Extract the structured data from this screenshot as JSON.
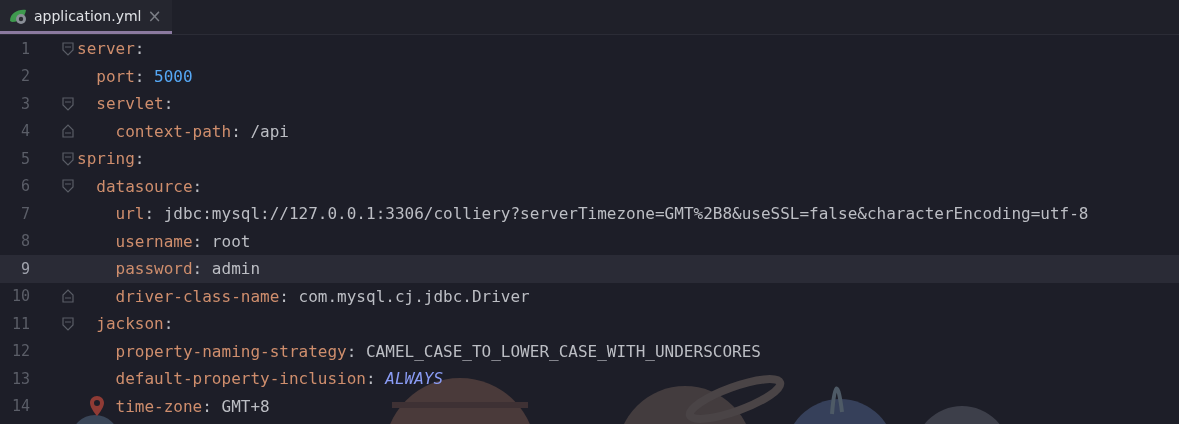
{
  "tabs": [
    {
      "label": "application.yml",
      "selected": true,
      "close": "×"
    }
  ],
  "lines": [
    {
      "number": "1",
      "key": "server",
      "separator": ":",
      "current": false,
      "marked": false,
      "children": [
        {
          "number": "2",
          "key": "port",
          "separator": ":",
          "value": "5000",
          "kind": "number",
          "current": false,
          "marked": false
        },
        {
          "number": "3",
          "key": "servlet",
          "separator": ":",
          "current": false,
          "marked": false,
          "children": [
            {
              "number": "4",
              "key": "context-path",
              "separator": ":",
              "value": "/api",
              "kind": "string",
              "current": false,
              "marked": false
            }
          ]
        }
      ]
    },
    {
      "number": "5",
      "key": "spring",
      "separator": ":",
      "current": false,
      "marked": false,
      "children": [
        {
          "number": "6",
          "key": "datasource",
          "separator": ":",
          "current": false,
          "marked": false,
          "children": [
            {
              "number": "7",
              "key": "url",
              "separator": ":",
              "value": "jdbc:mysql://127.0.0.1:3306/colliery?serverTimezone=GMT%2B8&useSSL=false&characterEncoding=utf-8",
              "kind": "string",
              "current": false,
              "marked": false
            },
            {
              "number": "8",
              "key": "username",
              "separator": ":",
              "value": "root",
              "kind": "string",
              "current": false,
              "marked": false
            },
            {
              "number": "9",
              "key": "password",
              "separator": ":",
              "value": "admin",
              "kind": "string",
              "current": true,
              "marked": false
            },
            {
              "number": "10",
              "key": "driver-class-name",
              "separator": ":",
              "value": "com.mysql.cj.jdbc.Driver",
              "kind": "string",
              "current": false,
              "marked": false
            }
          ]
        },
        {
          "number": "11",
          "key": "jackson",
          "separator": ":",
          "current": false,
          "marked": false,
          "children": [
            {
              "number": "12",
              "key": "property-naming-strategy",
              "separator": ":",
              "value": "CAMEL_CASE_TO_LOWER_CASE_WITH_UNDERSCORES",
              "kind": "string",
              "current": false,
              "marked": false
            },
            {
              "number": "13",
              "key": "default-property-inclusion",
              "separator": ":",
              "value": "ALWAYS",
              "kind": "constant",
              "current": false,
              "marked": false
            },
            {
              "number": "14",
              "key": "time-zone",
              "separator": ":",
              "value": "GMT+8",
              "kind": "string",
              "current": false,
              "marked": true
            }
          ]
        }
      ]
    }
  ]
}
